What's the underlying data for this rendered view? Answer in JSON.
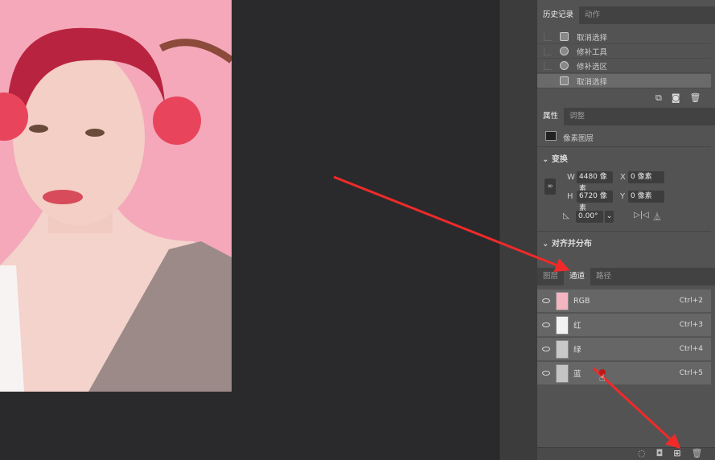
{
  "history_panel": {
    "tabs": [
      {
        "label": "历史记录",
        "active": true
      },
      {
        "label": "动作",
        "active": false
      }
    ],
    "items": [
      {
        "label": "取消选择",
        "icon": "document-icon",
        "selected": false
      },
      {
        "label": "修补工具",
        "icon": "patch-tool-icon",
        "selected": false
      },
      {
        "label": "修补选区",
        "icon": "patch-tool-icon",
        "selected": false
      },
      {
        "label": "取消选择",
        "icon": "document-icon",
        "selected": true
      }
    ]
  },
  "properties_panel": {
    "tabs": [
      {
        "label": "属性",
        "active": true
      },
      {
        "label": "调整",
        "active": false
      }
    ],
    "layer_type": "像素图层",
    "transform_title": "变换",
    "w_label": "W",
    "w_value": "4480 像素",
    "x_label": "X",
    "x_value": "0 像素",
    "h_label": "H",
    "h_value": "6720 像素",
    "y_label": "Y",
    "y_value": "0 像素",
    "angle_value": "0.00°",
    "align_title": "对齐并分布"
  },
  "channels_panel": {
    "tabs": [
      {
        "label": "图层",
        "active": false
      },
      {
        "label": "通道",
        "active": true
      },
      {
        "label": "路径",
        "active": false
      }
    ],
    "channels": [
      {
        "name": "RGB",
        "shortcut": "Ctrl+2"
      },
      {
        "name": "红",
        "shortcut": "Ctrl+3"
      },
      {
        "name": "绿",
        "shortcut": "Ctrl+4"
      },
      {
        "name": "蓝",
        "shortcut": "Ctrl+5"
      }
    ]
  },
  "colors": {
    "annotation_arrow": "#f02a2a",
    "photo_bg": "#f6a9bb"
  }
}
